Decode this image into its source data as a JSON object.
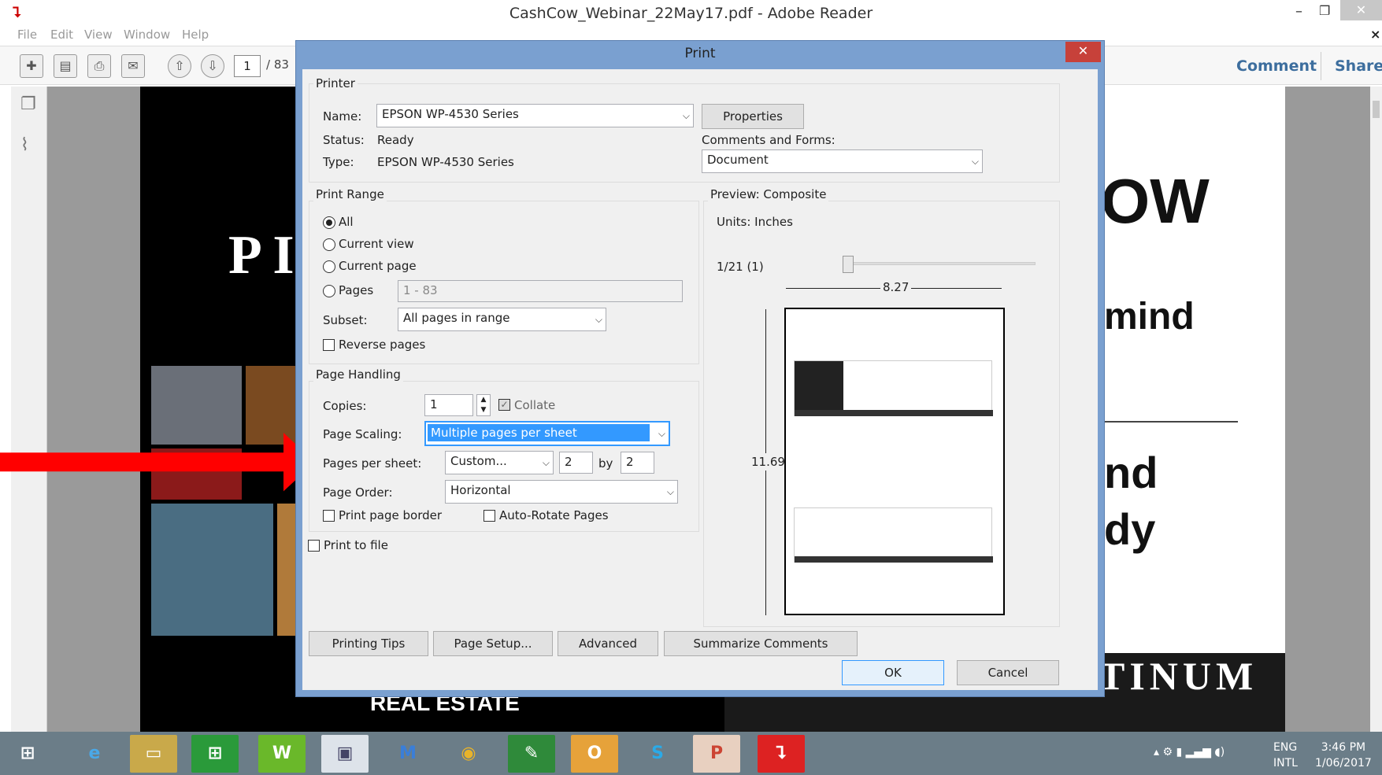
{
  "app": {
    "title": "CashCow_Webinar_22May17.pdf - Adobe Reader",
    "menu": [
      "File",
      "Edit",
      "View",
      "Window",
      "Help"
    ],
    "page_current": "1",
    "page_total": "/ 83",
    "comment_label": "Comment",
    "share_label": "Share"
  },
  "document": {
    "left_text": "P I",
    "right_top": "OW",
    "right_mind": "mind",
    "right_nd": "nd",
    "right_dy": "dy",
    "bottom_left": "REAL ESTATE",
    "bottom_right": "TINUM"
  },
  "dialog": {
    "title": "Print",
    "close": "✕",
    "printer": {
      "legend": "Printer",
      "name_label": "Name:",
      "name_value": "EPSON WP-4530 Series",
      "properties_button": "Properties",
      "status_label": "Status:",
      "status_value": "Ready",
      "type_label": "Type:",
      "type_value": "EPSON WP-4530 Series",
      "comments_label": "Comments and Forms:",
      "comments_value": "Document"
    },
    "range": {
      "legend": "Print Range",
      "all": "All",
      "current_view": "Current view",
      "current_page": "Current page",
      "pages": "Pages",
      "pages_value": "1 - 83",
      "subset_label": "Subset:",
      "subset_value": "All pages in range",
      "reverse": "Reverse pages"
    },
    "handling": {
      "legend": "Page Handling",
      "copies_label": "Copies:",
      "copies_value": "1",
      "collate": "Collate",
      "scaling_label": "Page Scaling:",
      "scaling_value": "Multiple pages per sheet",
      "pps_label": "Pages per sheet:",
      "pps_value": "Custom...",
      "pps_x": "2",
      "by": "by",
      "pps_y": "2",
      "order_label": "Page Order:",
      "order_value": "Horizontal",
      "border": "Print page border",
      "autorotate": "Auto-Rotate Pages"
    },
    "print_to_file": "Print to file",
    "preview": {
      "legend": "Preview: Composite",
      "units": "Units: Inches",
      "page_indicator": "1/21 (1)",
      "width": "8.27",
      "height": "11.69"
    },
    "buttons": {
      "tips": "Printing Tips",
      "setup": "Page Setup...",
      "advanced": "Advanced",
      "summarize": "Summarize Comments",
      "ok": "OK",
      "cancel": "Cancel"
    }
  },
  "taskbar": {
    "lang_top": "ENG",
    "lang_bottom": "INTL",
    "time": "3:46 PM",
    "date": "1/06/2017"
  },
  "colors": {
    "accent": "#3d6e9e",
    "selection": "#3399ff",
    "arrow": "#ff0000"
  }
}
